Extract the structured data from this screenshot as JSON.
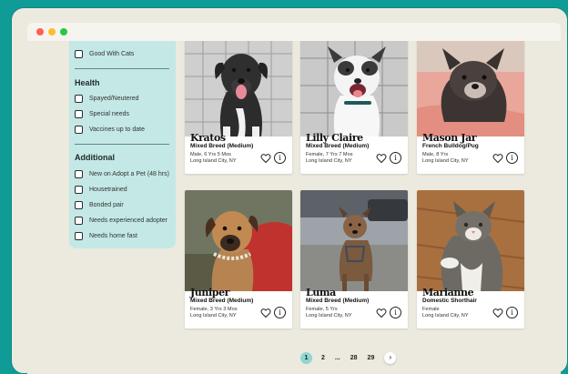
{
  "sidebar": {
    "top_filter": "Good With Cats",
    "health_title": "Health",
    "health": [
      "Spayed/Neutered",
      "Special needs",
      "Vaccines up to date"
    ],
    "additional_title": "Additional",
    "additional": [
      "New on Adopt a Pet (48 hrs)",
      "Housetrained",
      "Bonded pair",
      "Needs experienced adopter",
      "Needs home fast"
    ]
  },
  "pets": [
    {
      "name": "Kratos",
      "breed": "Mixed Breed (Medium)",
      "meta1": "Male, 6 Yrs 5 Mos",
      "meta2": "Long Island City, NY"
    },
    {
      "name": "Lilly Claire",
      "breed": "Mixed Breed (Medium)",
      "meta1": "Female, 7 Yrs 7 Mos",
      "meta2": "Long Island City, NY"
    },
    {
      "name": "Mason Jar",
      "breed": "French Bulldog/Pug",
      "meta1": "Male, 8 Yrs",
      "meta2": "Long Island City, NY"
    },
    {
      "name": "Juniper",
      "breed": "Mixed Breed (Medium)",
      "meta1": "Female, 3 Yrs 3 Mos",
      "meta2": "Long Island City, NY"
    },
    {
      "name": "Luma",
      "breed": "Mixed Breed (Medium)",
      "meta1": "Female, 5 Yrs",
      "meta2": "Long Island City, NY"
    },
    {
      "name": "Marianne",
      "breed": "Domestic Shorthair",
      "meta1": "Female",
      "meta2": "Long Island City, NY"
    }
  ],
  "pagination": {
    "pages": [
      "1",
      "2",
      "...",
      "28",
      "29"
    ],
    "next": "›"
  },
  "icons": {
    "heart": "heart-icon",
    "info": "info-icon",
    "next": "chevron-right-icon"
  },
  "colors": {
    "teal_bg": "#0f9c96",
    "sidebar": "#c3e8e5",
    "page_active": "#8fd6d0"
  }
}
